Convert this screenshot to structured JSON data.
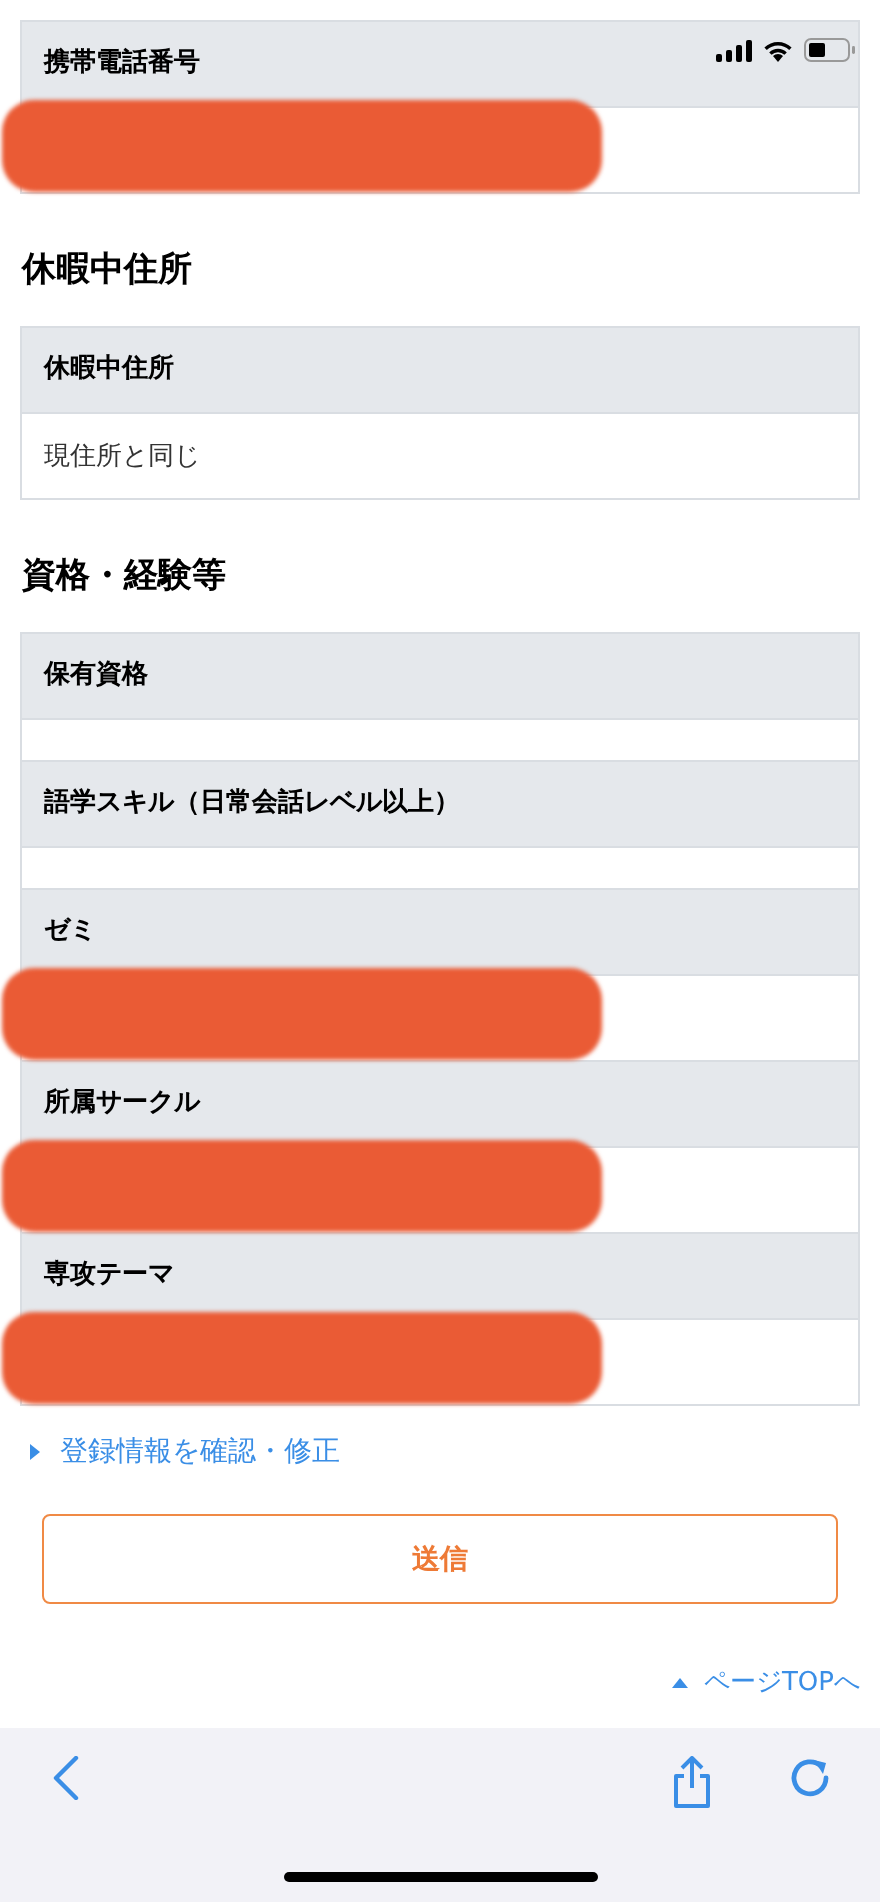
{
  "sections": [
    {
      "fields": [
        {
          "label": "携帯電話番号",
          "redacted": true
        }
      ]
    },
    {
      "title": "休暇中住所",
      "fields": [
        {
          "label": "休暇中住所",
          "value": "現住所と同じ",
          "redacted": false
        }
      ]
    },
    {
      "title": "資格・経験等",
      "fields": [
        {
          "label": "保有資格",
          "redacted": false
        },
        {
          "label": "語学スキル（日常会話レベル以上）",
          "redacted": false
        },
        {
          "label": "ゼミ",
          "redacted": true
        },
        {
          "label": "所属サークル",
          "redacted": true
        },
        {
          "label": "専攻テーマ",
          "redacted": true
        }
      ]
    }
  ],
  "edit_link": "登録情報を確認・修正",
  "submit_button": "送信",
  "page_top_link": "ページTOPへ"
}
